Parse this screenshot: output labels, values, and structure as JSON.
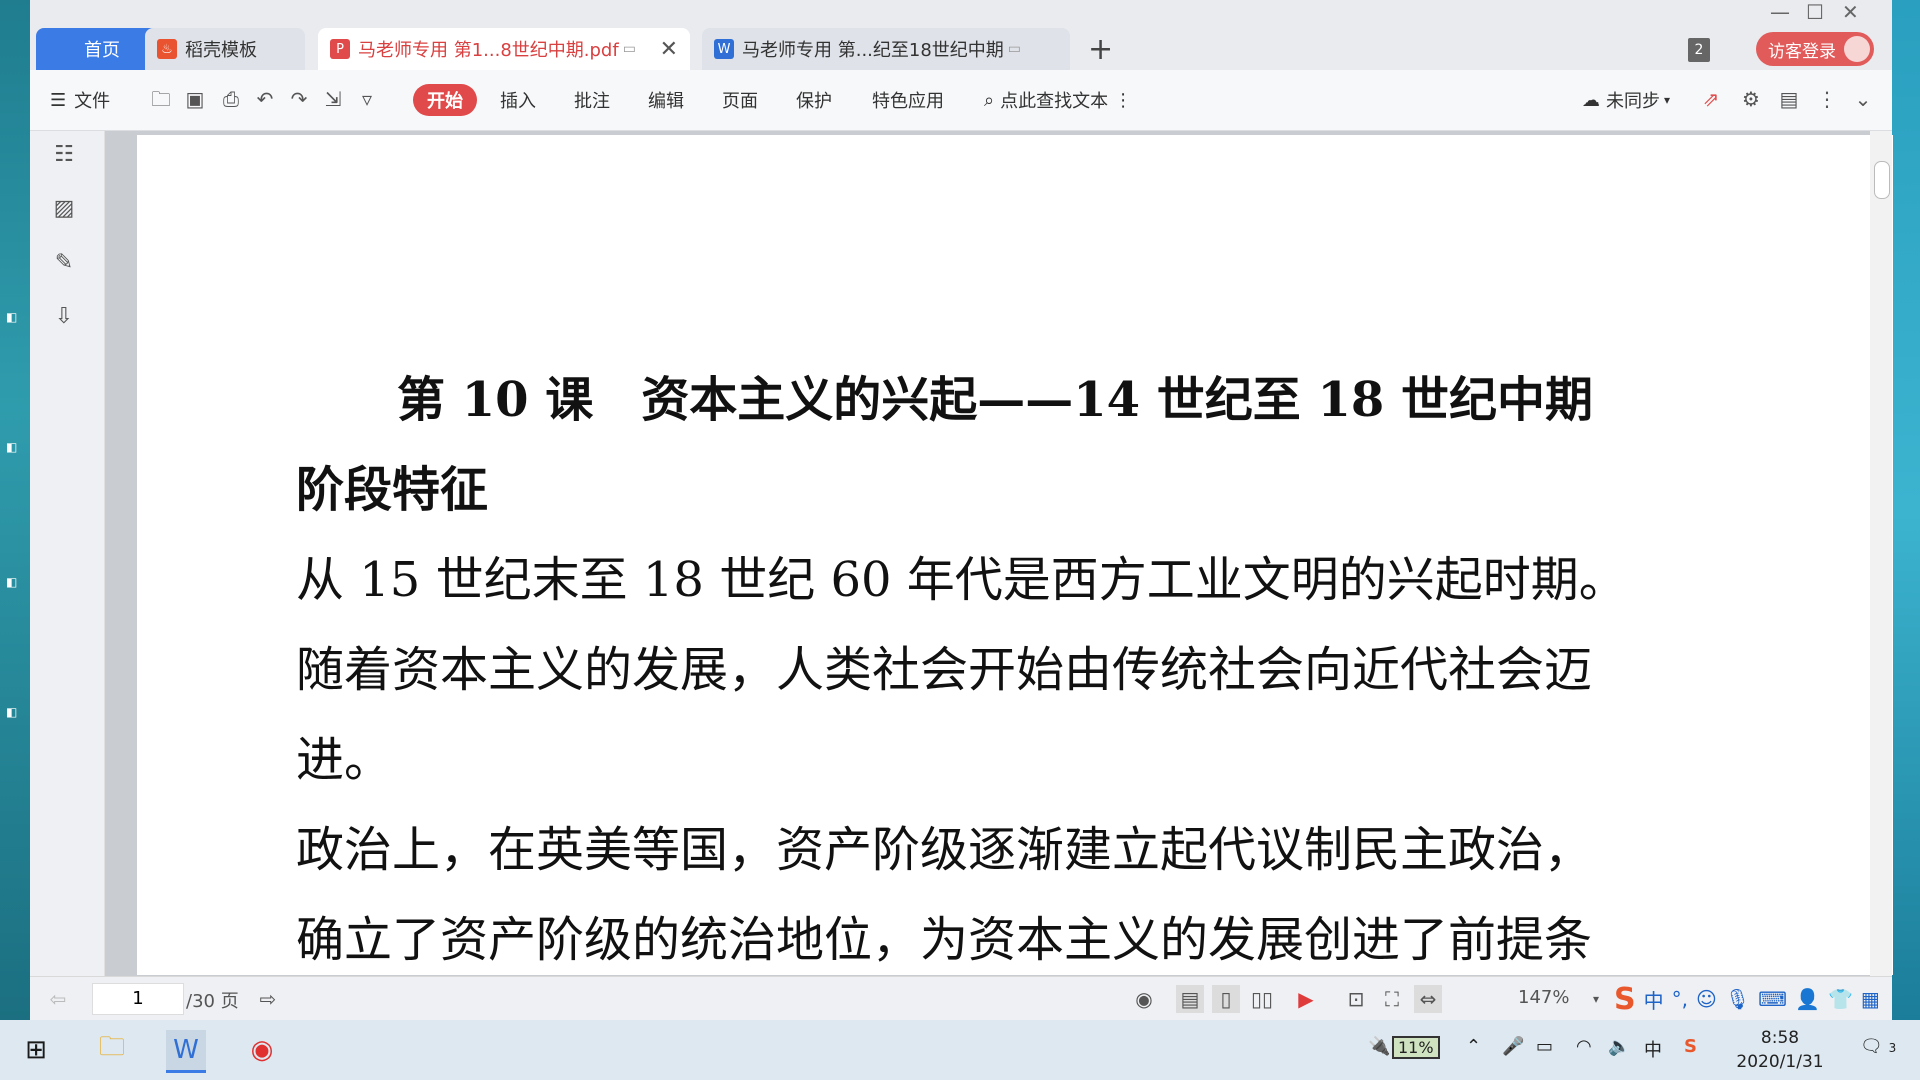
{
  "tabs": {
    "home": "首页",
    "daoke": "稻壳模板",
    "pdf": "马老师专用  第1...8世纪中期.pdf",
    "doc": "马老师专用  第...纪至18世纪中期",
    "badge_count": "2",
    "login": "访客登录"
  },
  "toolbar": {
    "file": "文件",
    "start": "开始",
    "insert": "插入",
    "annotate": "批注",
    "edit": "编辑",
    "page": "页面",
    "protect": "保护",
    "special": "特色应用",
    "search": "点此查找文本",
    "sync": "未同步"
  },
  "document": {
    "title": "第 10 课　资本主义的兴起——14 世纪至 18 世纪中期",
    "subhead": "阶段特征",
    "lines": [
      "从 15 世纪末至 18 世纪 60 年代是西方工业文明的兴起时期。",
      "随着资本主义的发展，人类社会开始由传统社会向近代社会迈",
      "进。",
      "政治上，在英美等国，资产阶级逐渐建立起代议制民主政治，",
      "确立了资产阶级的统治地位，为资本主义的发展创进了前提条"
    ]
  },
  "statusbar": {
    "page_current": "1",
    "page_total": "/30 页",
    "zoom": "147%"
  },
  "ime": {
    "mode": "中"
  },
  "taskbar": {
    "battery": "11%",
    "lang": "中",
    "time": "8:58",
    "date": "2020/1/31",
    "notifications": "3"
  }
}
